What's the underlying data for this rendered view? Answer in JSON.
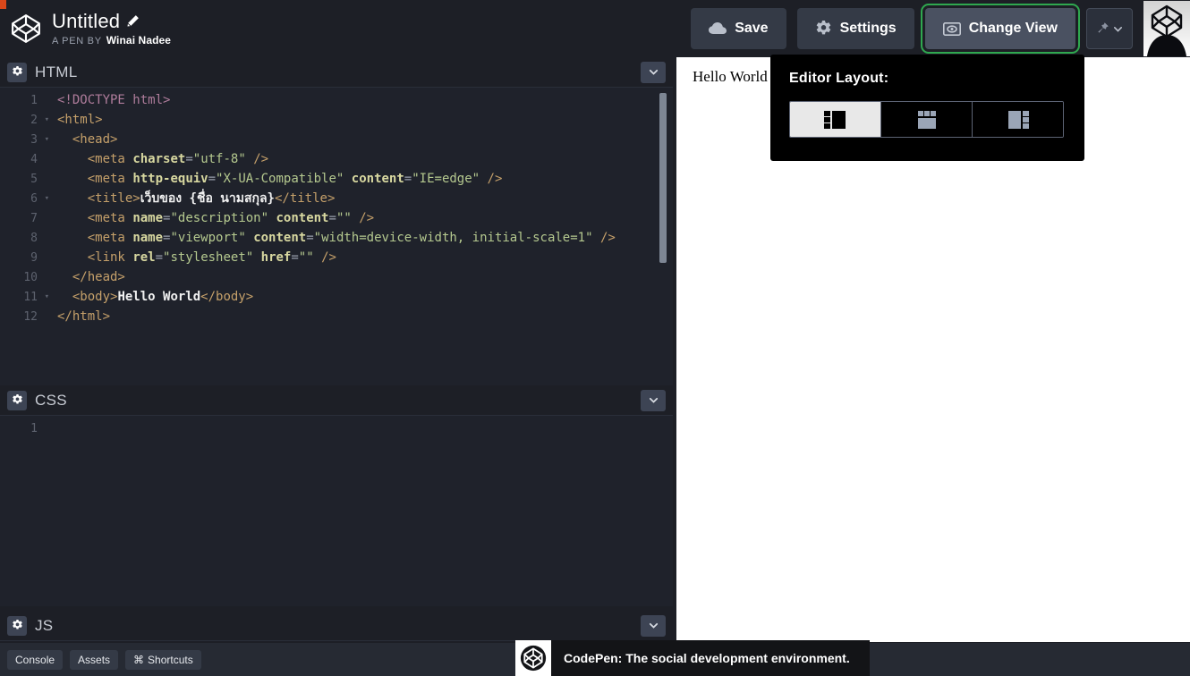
{
  "header": {
    "pen_title": "Untitled",
    "edit_icon": "pencil-icon",
    "byline_prefix": "A PEN BY",
    "author": "Winai Nadee",
    "buttons": {
      "save": "Save",
      "settings": "Settings",
      "change_view": "Change View"
    },
    "icons": {
      "save": "cloud-icon",
      "settings": "gear-icon",
      "change_view": "screen-icon",
      "pin": "pin-icon",
      "pin_chevron": "chevron-down-icon",
      "logo": "codepen-logo-icon",
      "avatar": "user-avatar"
    },
    "accent_green": "#2fa84f",
    "accent_orange": "#d9471a"
  },
  "dropdown": {
    "label": "Editor Layout:",
    "options": [
      {
        "name": "layout-left",
        "active": true
      },
      {
        "name": "layout-top",
        "active": false
      },
      {
        "name": "layout-right",
        "active": false
      }
    ]
  },
  "panes": {
    "html": {
      "title": "HTML",
      "gear": "gear-icon",
      "collapse": "chevron-down-icon"
    },
    "css": {
      "title": "CSS",
      "gear": "gear-icon",
      "collapse": "chevron-down-icon"
    },
    "js": {
      "title": "JS",
      "gear": "gear-icon",
      "collapse": "chevron-down-icon"
    }
  },
  "html_editor": {
    "lines": [
      {
        "n": 1,
        "fold": false,
        "indent": 1
      },
      {
        "n": 2,
        "fold": true,
        "indent": 0
      },
      {
        "n": 3,
        "fold": true,
        "indent": 1
      },
      {
        "n": 4,
        "fold": false,
        "indent": 2
      },
      {
        "n": 5,
        "fold": false,
        "indent": 2
      },
      {
        "n": 6,
        "fold": true,
        "indent": 2
      },
      {
        "n": 7,
        "fold": false,
        "indent": 2
      },
      {
        "n": 8,
        "fold": false,
        "indent": 2
      },
      {
        "n": 9,
        "fold": false,
        "indent": 2
      },
      {
        "n": 10,
        "fold": false,
        "indent": 1
      },
      {
        "n": 11,
        "fold": true,
        "indent": 1
      },
      {
        "n": 12,
        "fold": false,
        "indent": 0
      }
    ],
    "code": [
      "<!DOCTYPE html>",
      "<html>",
      "  <head>",
      "    <meta charset=\"utf-8\" />",
      "    <meta http-equiv=\"X-UA-Compatible\" content=\"IE=edge\" />",
      "    <title>เว็บของ {ชื่อ นามสกุล}</title>",
      "    <meta name=\"description\" content=\"\" />",
      "    <meta name=\"viewport\" content=\"width=device-width, initial-scale=1\" />",
      "    <link rel=\"stylesheet\" href=\"\" />",
      "  </head>",
      "  <body>Hello World</body>",
      "</html>"
    ]
  },
  "css_editor": {
    "lines": [
      {
        "n": 1
      }
    ],
    "code": [
      ""
    ]
  },
  "preview": {
    "body_text": "Hello World"
  },
  "bottom_bar": {
    "buttons": [
      {
        "label": "Console",
        "icon": ""
      },
      {
        "label": "Assets",
        "icon": ""
      },
      {
        "label": "Shortcuts",
        "icon": "command-icon"
      }
    ],
    "shortcuts_symbol": "⌘"
  },
  "tooltip": {
    "text": "CodePen: The social development environment.",
    "logo": "codepen-logo-icon"
  }
}
